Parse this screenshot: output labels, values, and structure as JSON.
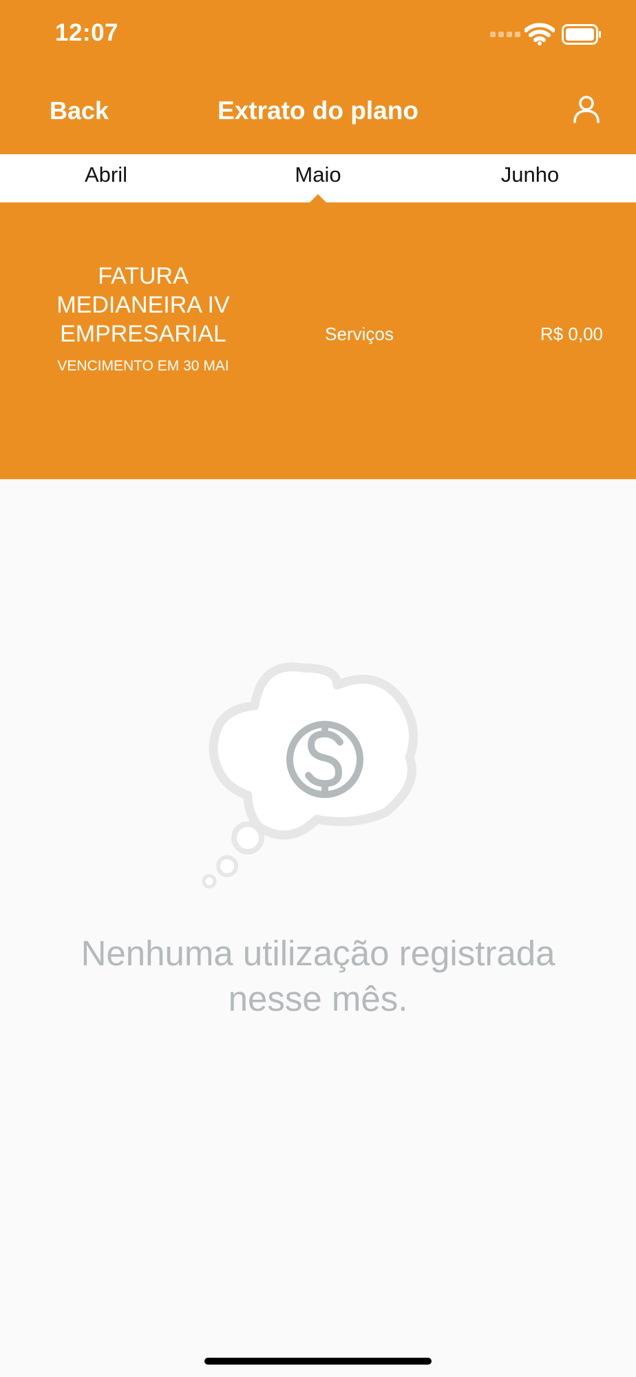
{
  "status_bar": {
    "time": "12:07"
  },
  "nav": {
    "back_label": "Back",
    "title": "Extrato do plano"
  },
  "tabs": [
    {
      "label": "Abril"
    },
    {
      "label": "Maio",
      "selected": true
    },
    {
      "label": "Junho"
    }
  ],
  "invoice": {
    "name": "FATURA MEDIANEIRA IV EMPRESARIAL",
    "due": "VENCIMENTO EM 30 MAI",
    "category": "Serviços",
    "value": "R$ 0,00"
  },
  "empty_state": {
    "message": "Nenhuma utilização registrada nesse mês."
  },
  "icons": [
    "wifi-icon",
    "battery-icon",
    "signal-icon",
    "user-icon",
    "dollar-cloud-icon"
  ],
  "colors": {
    "accent": "#ec8f22",
    "background": "#fafafa",
    "muted_text": "#b4b9bc"
  }
}
